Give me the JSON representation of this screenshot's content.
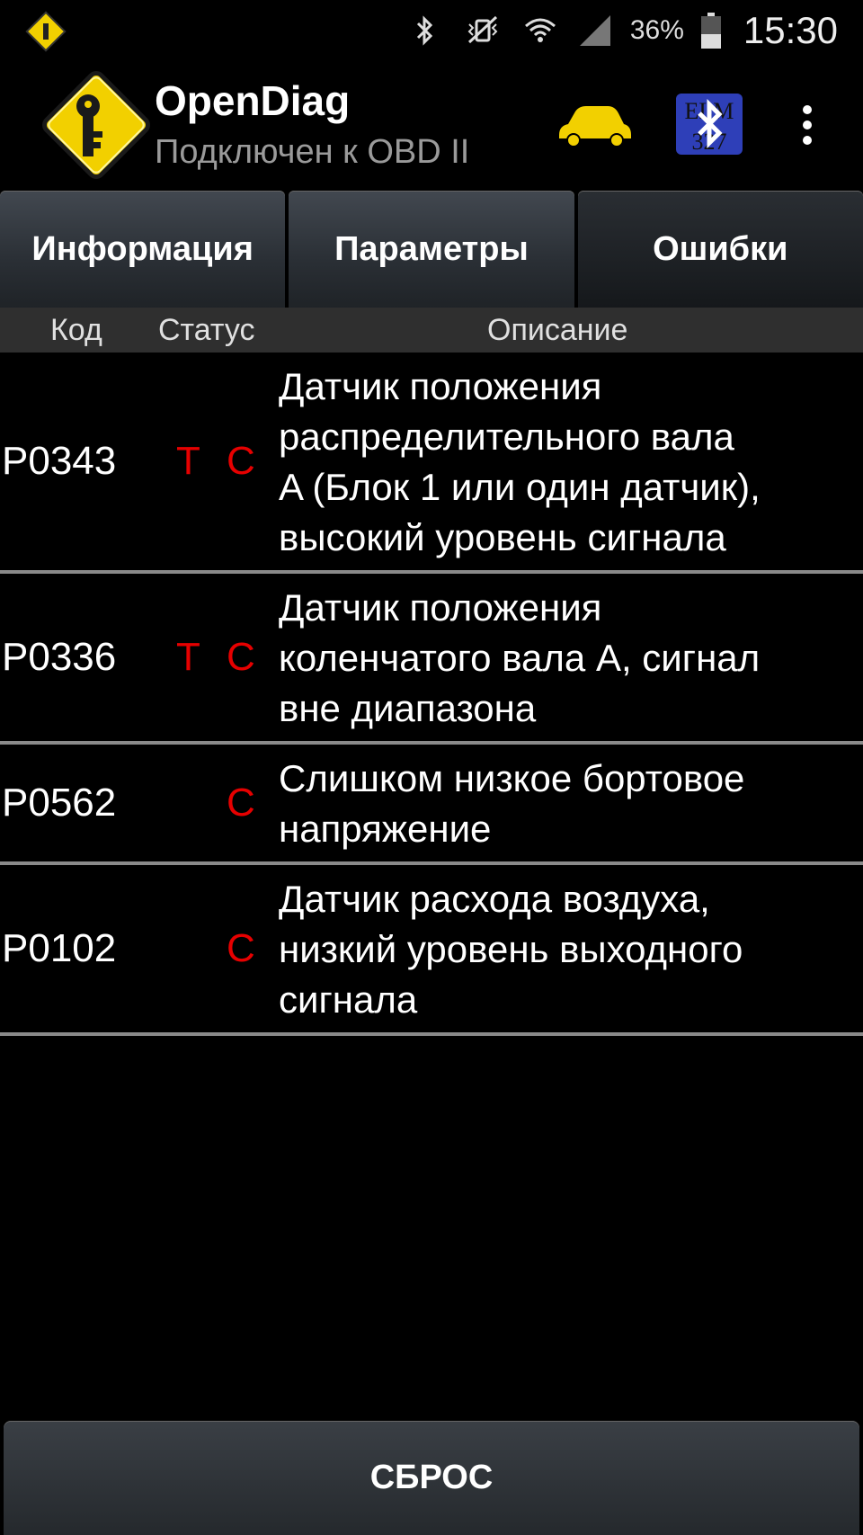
{
  "status_bar": {
    "battery": "36%",
    "time": "15:30",
    "icons": [
      "app-notification-icon",
      "bluetooth-icon",
      "vibrate-icon",
      "wifi-icon",
      "signal-icon",
      "battery-icon"
    ]
  },
  "action_bar": {
    "title": "OpenDiag",
    "subtitle": "Подключен к OBD II",
    "icons": [
      "app-logo-icon",
      "car-icon",
      "elm327-bluetooth-icon",
      "overflow-menu-icon"
    ],
    "logo_color": "#f2d000",
    "car_color": "#f2d000"
  },
  "tabs": [
    {
      "label": "Информация",
      "active": false
    },
    {
      "label": "Параметры",
      "active": false
    },
    {
      "label": "Ошибки",
      "active": true
    }
  ],
  "table": {
    "headers": {
      "code": "Код",
      "status": "Статус",
      "description": "Описание"
    },
    "rows": [
      {
        "code": "P0343",
        "t": "T",
        "c": "C",
        "desc": [
          "Датчик положения",
          "распределительного вала",
          "A (Блок 1 или один датчик),",
          "высокий уровень сигнала"
        ]
      },
      {
        "code": "P0336",
        "t": "T",
        "c": "C",
        "desc": [
          "Датчик положения",
          "коленчатого вала A, сигнал",
          "вне диапазона"
        ]
      },
      {
        "code": "P0562",
        "t": "",
        "c": "C",
        "desc": [
          "Слишком низкое бортовое",
          "напряжение"
        ]
      },
      {
        "code": "P0102",
        "t": "",
        "c": "C",
        "desc": [
          "Датчик расхода воздуха,",
          "низкий уровень выходного",
          "сигнала"
        ]
      }
    ],
    "status_color": "#e60000"
  },
  "reset_button": {
    "label": "СБРОС"
  }
}
